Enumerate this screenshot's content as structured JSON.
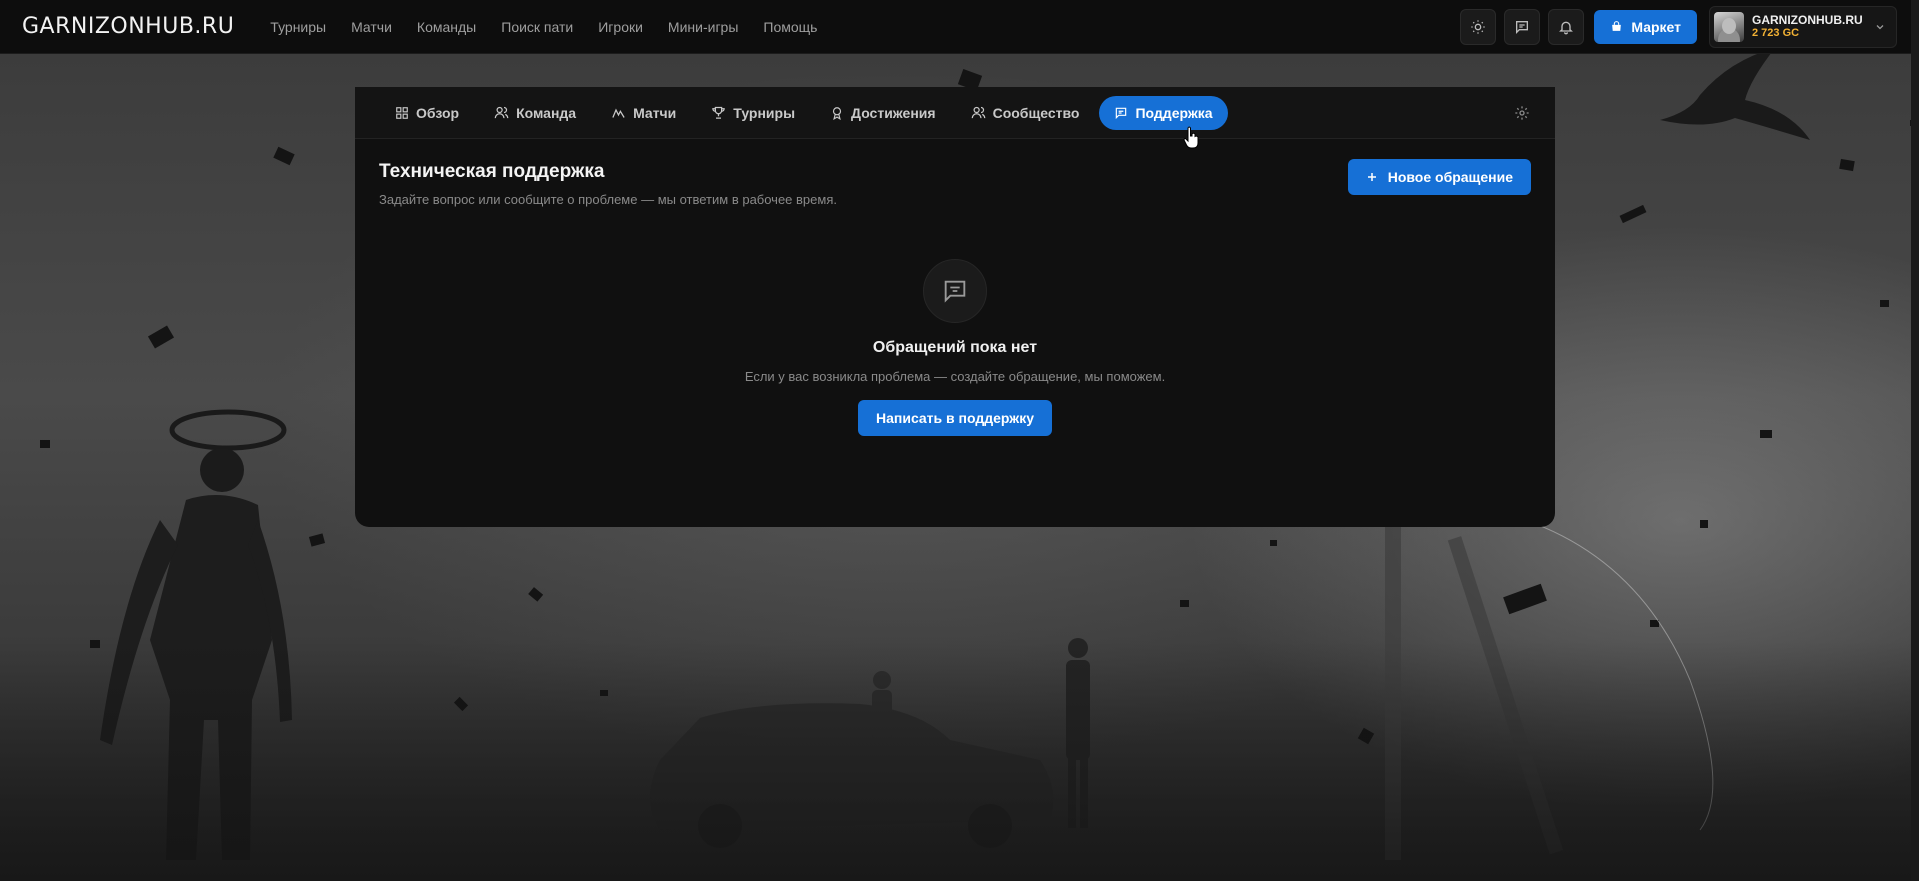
{
  "header": {
    "logo": "GARNIZONHUB.RU",
    "nav": [
      {
        "label": "Турниры"
      },
      {
        "label": "Матчи"
      },
      {
        "label": "Команды"
      },
      {
        "label": "Поиск пати"
      },
      {
        "label": "Игроки"
      },
      {
        "label": "Мини-игры"
      },
      {
        "label": "Помощь"
      }
    ],
    "market_label": "Маркет",
    "profile": {
      "name": "GARNIZONHUB.RU",
      "balance": "2 723 GC"
    },
    "icons": [
      "sun-icon",
      "chat-icon",
      "bell-icon",
      "shop-icon",
      "chevron-down-icon"
    ]
  },
  "tabs": [
    {
      "label": "Обзор",
      "icon": "grid-icon"
    },
    {
      "label": "Команда",
      "icon": "users-icon"
    },
    {
      "label": "Матчи",
      "icon": "activity-icon"
    },
    {
      "label": "Турниры",
      "icon": "trophy-icon"
    },
    {
      "label": "Достижения",
      "icon": "medal-icon"
    },
    {
      "label": "Сообщество",
      "icon": "community-icon"
    },
    {
      "label": "Поддержка",
      "icon": "support-chat-icon",
      "active": true
    }
  ],
  "support": {
    "title": "Техническая поддержка",
    "subtitle": "Задайте вопрос или сообщите о проблеме — мы ответим в рабочее время.",
    "new_request_label": "Новое обращение",
    "empty_title": "Обращений пока нет",
    "empty_text": "Если у вас возникла проблема — создайте обращение, мы поможем.",
    "write_label": "Написать в поддержку"
  },
  "colors": {
    "accent": "#1670d6",
    "balance": "#f2b134",
    "panel": "#101010",
    "topbar": "#0d0d0d"
  }
}
